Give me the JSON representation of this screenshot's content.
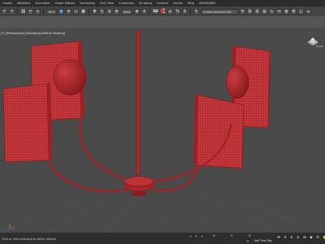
{
  "menu": [
    "Create",
    "Modifiers",
    "Animation",
    "Graph Editors",
    "Rendering",
    "Civil View",
    "Customize",
    "Scripting",
    "Content",
    "Arnold",
    "Help",
    "ZHAKHABO"
  ],
  "toolbar": {
    "view_dropdown": "View",
    "selection_set_placeholder": "Create Selection Set"
  },
  "viewport": {
    "label": "[+] [Perspective] [Standard] [Default Shading]",
    "background": "#4a4a4a",
    "wire_color": "#c0262b"
  },
  "viewcube_home_label": "HOME",
  "status": {
    "prompt": "Click or click-and-drag to select objects",
    "x_label": "X:",
    "y_label": "Y:",
    "z_label": "Z:",
    "add_time_tag": "Add Time Tag"
  },
  "icons": {
    "select": "select-icon",
    "move": "move-icon",
    "rotate": "rotate-icon",
    "scale": "scale-icon",
    "snap": "snap-icon",
    "render": "teapot-icon",
    "play": "play-icon"
  }
}
